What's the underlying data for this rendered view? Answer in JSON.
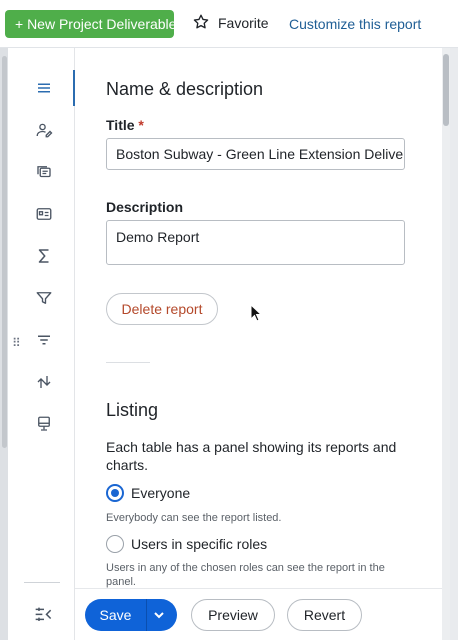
{
  "topbar": {
    "new_button_label": "+ New Project Deliverable",
    "favorite_label": "Favorite",
    "customize_label": "Customize this report"
  },
  "sidenav": {
    "icons": [
      "menu-lines-icon",
      "user-edit-icon",
      "gallery-icon",
      "id-card-icon",
      "sigma-icon",
      "filter-icon",
      "sort-lines-icon",
      "sort-arrows-icon",
      "kiosk-icon"
    ],
    "collapse_icon": "collapse-sidebar-icon"
  },
  "name_section": {
    "title": "Name & description",
    "title_label": "Title",
    "required_mark": "*",
    "title_value": "Boston Subway - Green Line Extension Delivera",
    "description_label": "Description",
    "description_value": "Demo Report",
    "delete_label": "Delete report"
  },
  "listing_section": {
    "title": "Listing",
    "intro": "Each table has a panel showing its reports and charts.",
    "options": [
      {
        "label": "Everyone",
        "hint": "Everybody can see the report listed.",
        "selected": true
      },
      {
        "label": "Users in specific roles",
        "hint": "Users in any of the chosen roles can see the report in the panel.",
        "selected": false
      }
    ]
  },
  "footer": {
    "save_label": "Save",
    "preview_label": "Preview",
    "revert_label": "Revert"
  },
  "colors": {
    "new_button": "#4fae4a",
    "link": "#1f5e95",
    "primary": "#0f63d8",
    "danger_text": "#b4492b"
  }
}
